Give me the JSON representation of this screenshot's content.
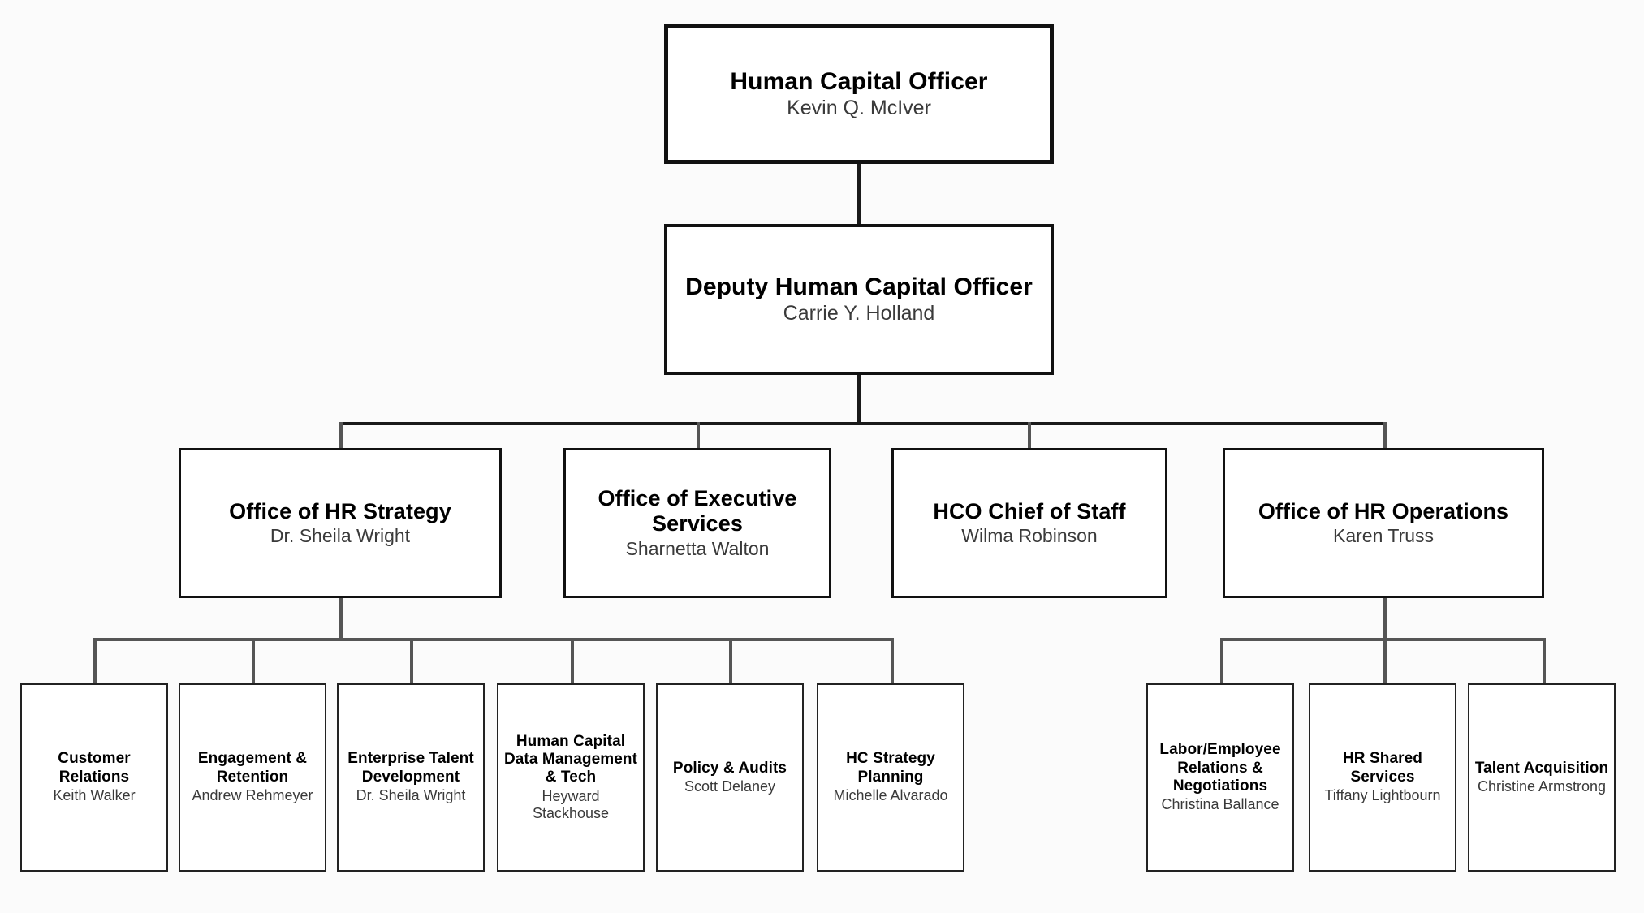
{
  "chart": {
    "type": "org-chart",
    "title": "Human Capital Officer Organization Chart",
    "nodes": {
      "hco": {
        "title": "Human Capital Officer",
        "person": "Kevin Q. McIver",
        "level": 1
      },
      "dhco": {
        "title": "Deputy Human Capital Officer",
        "person": "Carrie Y. Holland",
        "level": 2
      },
      "hr_strategy": {
        "title": "Office of HR Strategy",
        "person": "Dr. Sheila Wright",
        "level": 3
      },
      "exec_services": {
        "title": "Office of Executive Services",
        "person": "Sharnetta Walton",
        "level": 3
      },
      "chief_of_staff": {
        "title": "HCO Chief of Staff",
        "person": "Wilma Robinson",
        "level": 3
      },
      "hr_operations": {
        "title": "Office of HR Operations",
        "person": "Karen Truss",
        "level": 3
      },
      "customer_relations": {
        "title": "Customer Relations",
        "person": "Keith Walker",
        "level": 4
      },
      "engagement_retention": {
        "title": "Engagement & Retention",
        "person": "Andrew Rehmeyer",
        "level": 4
      },
      "enterprise_talent": {
        "title": "Enterprise Talent Development",
        "person": "Dr. Sheila Wright",
        "level": 4
      },
      "hc_data_mgmt": {
        "title": "Human Capital Data Management & Tech",
        "person": "Heyward Stackhouse",
        "level": 4
      },
      "policy_audits": {
        "title": "Policy & Audits",
        "person": "Scott Delaney",
        "level": 4
      },
      "hc_strategy_planning": {
        "title": "HC Strategy Planning",
        "person": "Michelle Alvarado",
        "level": 4
      },
      "labor_employee": {
        "title": "Labor/Employee Relations & Negotiations",
        "person": "Christina Ballance",
        "level": 4
      },
      "hr_shared_services": {
        "title": "HR Shared Services",
        "person": "Tiffany Lightbourn",
        "level": 4
      },
      "talent_acquisition": {
        "title": "Talent Acquisition",
        "person": "Christine Armstrong",
        "level": 4
      }
    },
    "colors": {
      "background": "#fbfbfb",
      "box_fill": "#ffffff",
      "box_border": "#111111",
      "title_text": "#000000",
      "person_text": "#3a3a3a",
      "connector": "#1a1a1a"
    }
  }
}
